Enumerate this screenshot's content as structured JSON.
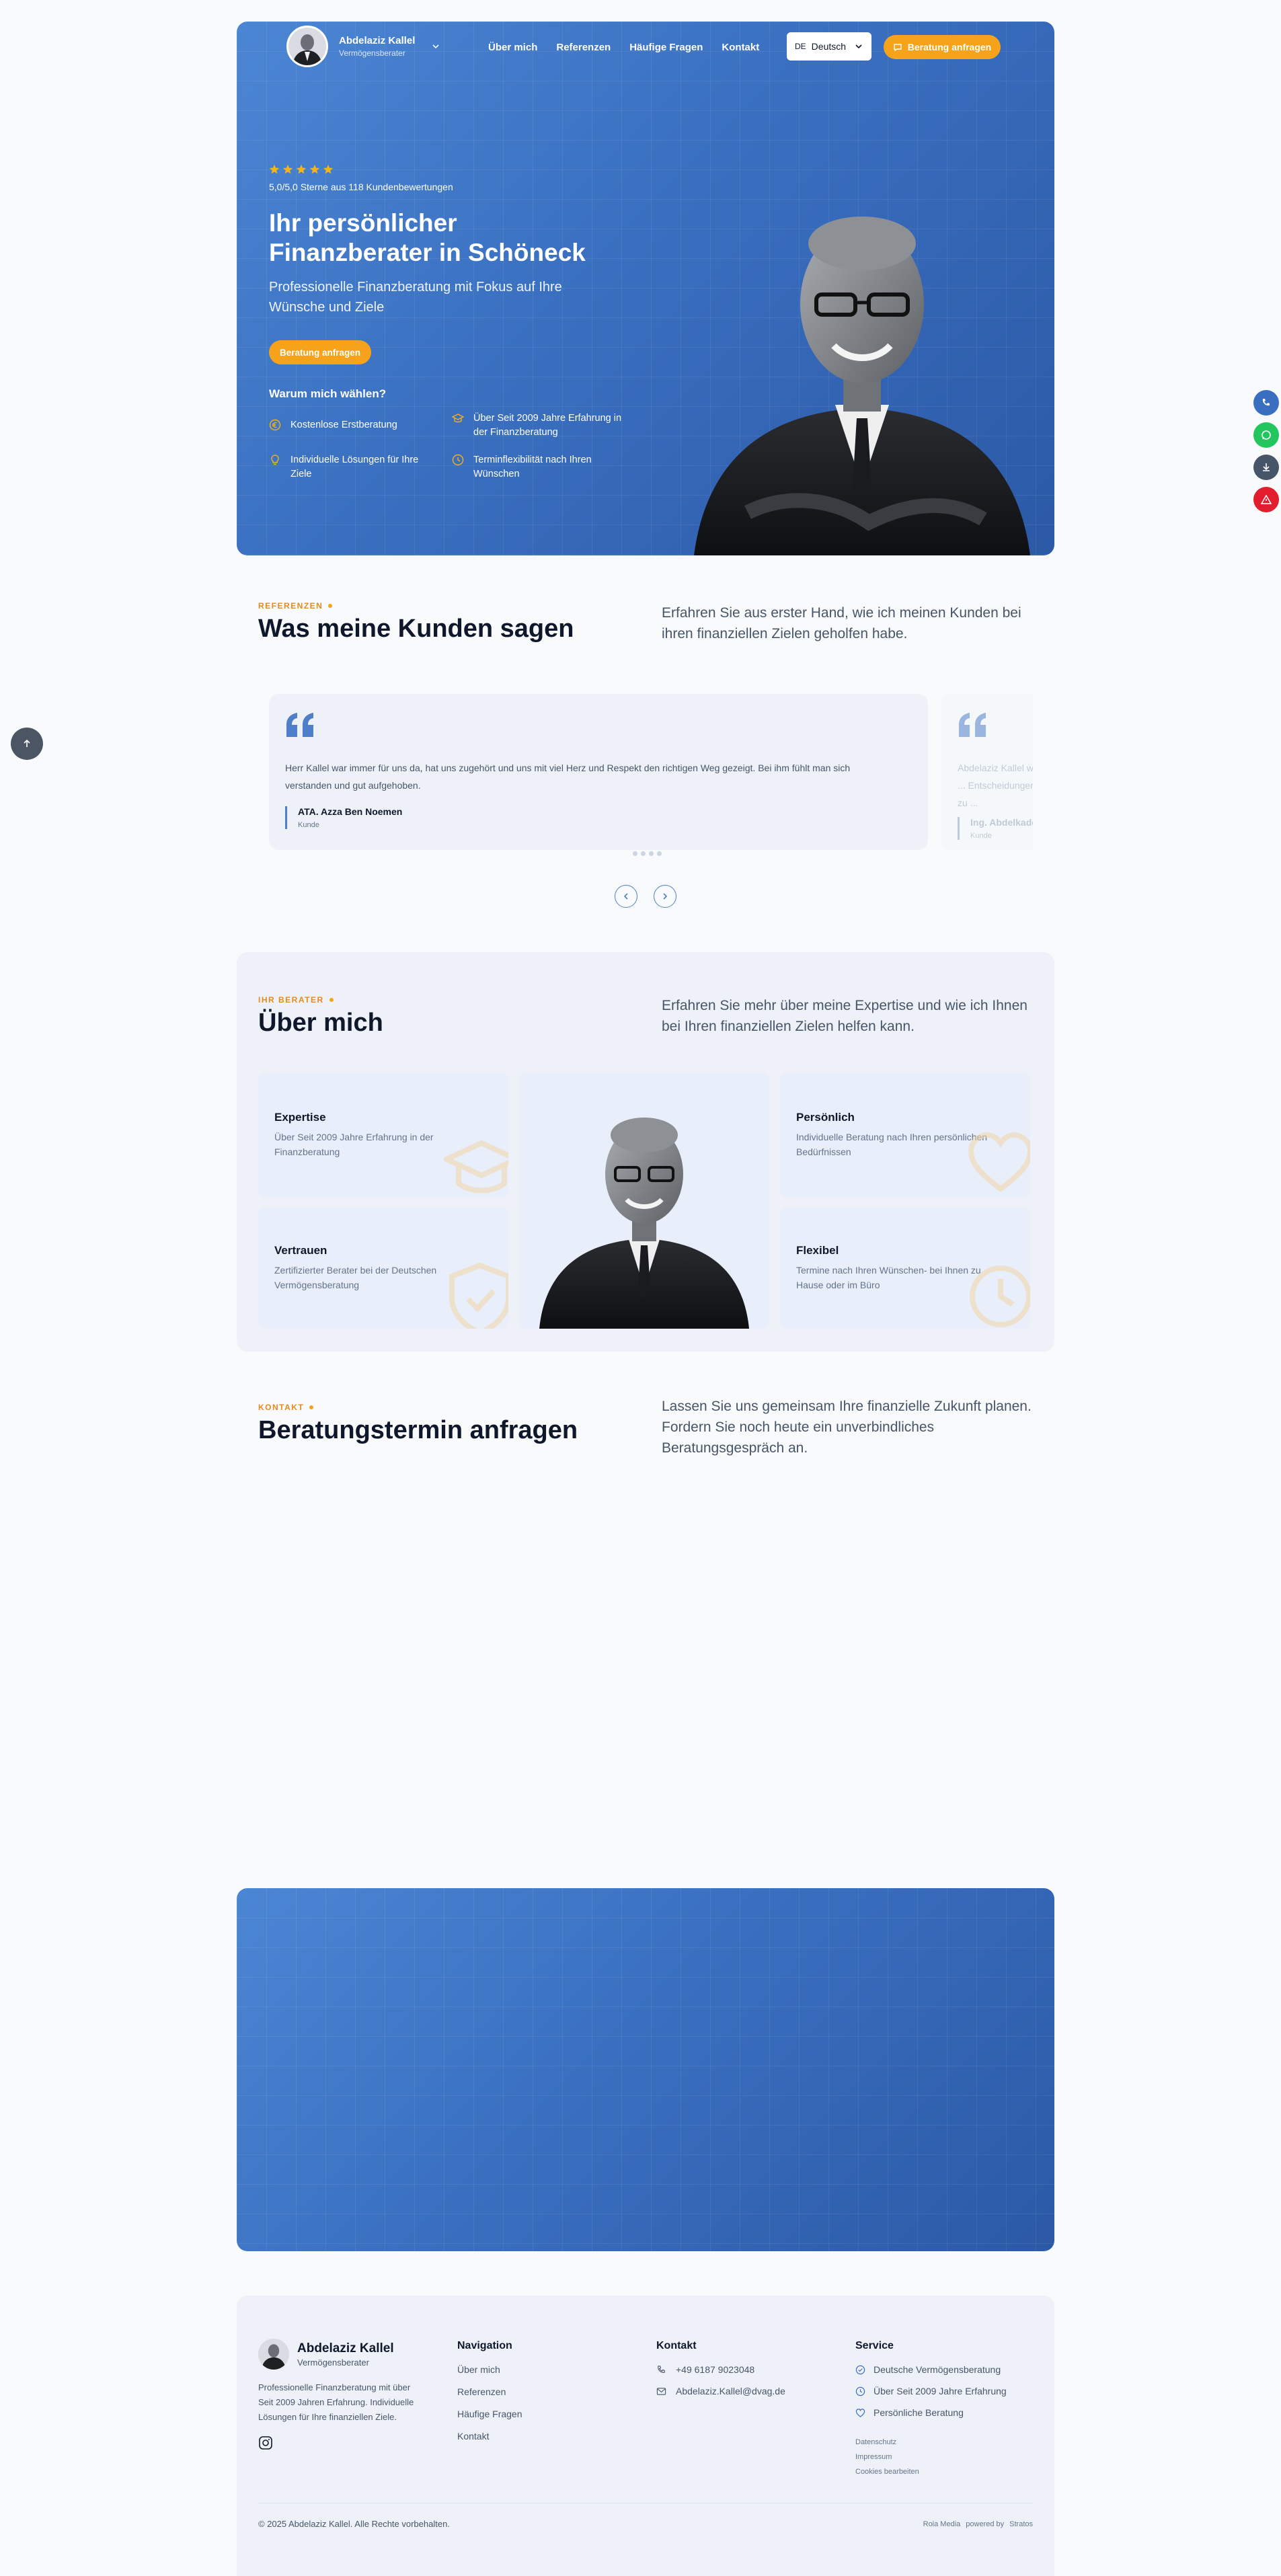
{
  "header": {
    "name": "Abdelaziz Kallel",
    "role": "Vermögensberater",
    "nav": [
      "Über mich",
      "Referenzen",
      "Häufige Fragen",
      "Kontakt"
    ],
    "lang_code": "DE",
    "lang_label": "Deutsch",
    "cta": "Beratung anfragen"
  },
  "hero": {
    "rating_text": "5,0/5,0 Sterne aus 118 Kundenbewertungen",
    "stars": 5,
    "title_line1": "Ihr persönlicher",
    "title_line2": "Finanzberater in Schöneck",
    "subtitle_line1": "Professionelle Finanzberatung mit Fokus auf Ihre",
    "subtitle_line2": "Wünsche und Ziele",
    "cta": "Beratung anfragen",
    "why_title": "Warum mich wählen?",
    "features": [
      {
        "icon": "euro-icon",
        "text": "Kostenlose Erstberatung"
      },
      {
        "icon": "graduation-cap-icon",
        "text": "Über Seit 2009 Jahre Erfahrung in der Finanzberatung"
      },
      {
        "icon": "lightbulb-icon",
        "text": "Individuelle Lösungen für Ihre Ziele"
      },
      {
        "icon": "clock-icon",
        "text": "Terminflexibilität nach Ihren Wünschen"
      }
    ]
  },
  "references": {
    "eyebrow": "REFERENZEN",
    "title": "Was meine Kunden sagen",
    "lead": "Erfahren Sie aus erster Hand, wie ich meinen Kunden bei ihren finanziellen Zielen geholfen habe.",
    "testimonials": [
      {
        "text": "Herr Kallel war immer für uns da, hat uns zugehört und uns mit viel Herz und Respekt den richtigen Weg gezeigt. Bei ihm fühlt man sich verstanden und gut aufgehoben.",
        "author": "ATA. Azza Ben Noemen",
        "role": "Kunde"
      },
      {
        "text": "Abdelaziz Kallel war ... Entscheidungen zu ...",
        "author": "Ing. Abdelkader ...",
        "role": "Kunde"
      }
    ]
  },
  "about": {
    "eyebrow": "IHR BERATER",
    "title": "Über mich",
    "lead": "Erfahren Sie mehr über meine Expertise und wie ich Ihnen bei Ihren finanziellen Zielen helfen kann.",
    "cards": [
      {
        "title": "Expertise",
        "text": "Über Seit 2009 Jahre Erfahrung in der Finanzberatung"
      },
      {
        "title": "Vertrauen",
        "text": "Zertifizierter Berater bei der Deutschen Vermögensberatung"
      },
      {
        "title": "Persönlich",
        "text": "Individuelle Beratung nach Ihren persönlichen Bedürfnissen"
      },
      {
        "title": "Flexibel",
        "text": "Termine nach Ihren Wünschen- bei Ihnen zu Hause oder im Büro"
      }
    ]
  },
  "contact": {
    "eyebrow": "KONTAKT",
    "title": "Beratungstermin anfragen",
    "lead": "Lassen Sie uns gemeinsam Ihre finanzielle Zukunft planen. Fordern Sie noch heute ein unverbindliches Beratungsgespräch an."
  },
  "footer": {
    "name": "Abdelaziz Kallel",
    "role": "Vermögensberater",
    "desc": "Professionelle Finanzberatung mit über Seit 2009 Jahren Erfahrung. Individuelle Lösungen für Ihre finanziellen Ziele.",
    "nav_title": "Navigation",
    "nav": [
      "Über mich",
      "Referenzen",
      "Häufige Fragen",
      "Kontakt"
    ],
    "contact_title": "Kontakt",
    "phone": "+49 6187 9023048",
    "email": "Abdelaziz.Kallel@dvag.de",
    "service_title": "Service",
    "services": [
      "Deutsche Vermögensberatung",
      "Über Seit 2009 Jahre Erfahrung",
      "Persönliche Beratung"
    ],
    "legal": [
      "Datenschutz",
      "Impressum",
      "Cookies bearbeiten"
    ],
    "copyright": "© 2025 Abdelaziz Kallel. Alle Rechte vorbehalten.",
    "credit_1": "Roia Media",
    "credit_2": "powered by",
    "credit_3": "Stratos"
  },
  "colors": {
    "primary_blue": "#3a6fc0",
    "accent_orange": "#f6a21a",
    "dark_text": "#0f172a"
  }
}
